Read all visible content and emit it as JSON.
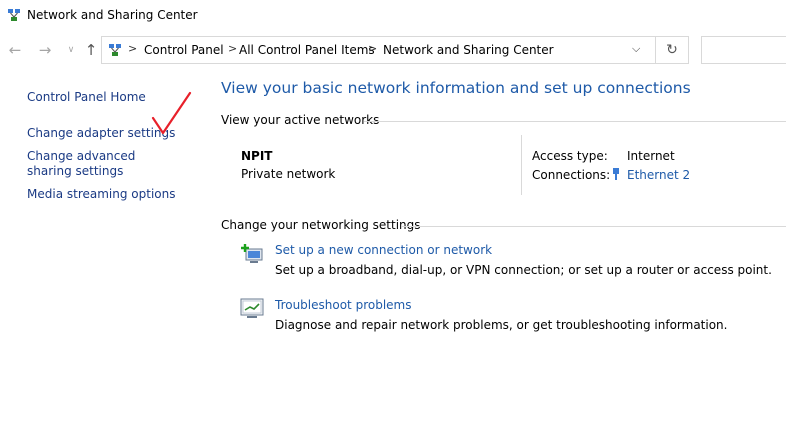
{
  "window": {
    "title": "Network and Sharing Center",
    "icon": "network-center-icon"
  },
  "nav": {
    "back_icon": "back-arrow-icon",
    "forward_icon": "forward-arrow-icon",
    "recent_icon": "chevron-down-icon",
    "up_icon": "up-arrow-icon",
    "separator": ">",
    "breadcrumbs": [
      "Control Panel",
      "All Control Panel Items",
      "Network and Sharing Center"
    ],
    "dropdown_glyph": "⌵",
    "refresh_glyph": "↻",
    "search_placeholder": ""
  },
  "sidebar": {
    "items": [
      {
        "label": "Control Panel Home"
      },
      {
        "label": "Change adapter settings"
      },
      {
        "label": "Change advanced sharing settings"
      },
      {
        "label": "Media streaming options"
      }
    ],
    "annotation": {
      "icon": "red-checkmark-annotation",
      "color": "#e8202a"
    }
  },
  "main": {
    "title": "View your basic network information and set up connections",
    "active_networks": {
      "heading": "View your active networks",
      "network_name": "NPIT",
      "network_category": "Private network",
      "access_type_label": "Access type:",
      "access_type_value": "Internet",
      "connections_label": "Connections:",
      "connections_value": "Ethernet 2",
      "connections_icon": "ethernet-icon"
    },
    "settings": {
      "heading": "Change your networking settings",
      "tasks": [
        {
          "icon": "new-connection-icon",
          "link": "Set up a new connection or network",
          "description": "Set up a broadband, dial-up, or VPN connection; or set up a router or access point."
        },
        {
          "icon": "troubleshoot-icon",
          "link": "Troubleshoot problems",
          "description": "Diagnose and repair network problems, or get troubleshooting information."
        }
      ]
    }
  },
  "colors": {
    "link": "#1e5aa8",
    "sidebar_link": "#1a3a84",
    "divider": "#d9d9d9",
    "annotation": "#e8202a"
  }
}
